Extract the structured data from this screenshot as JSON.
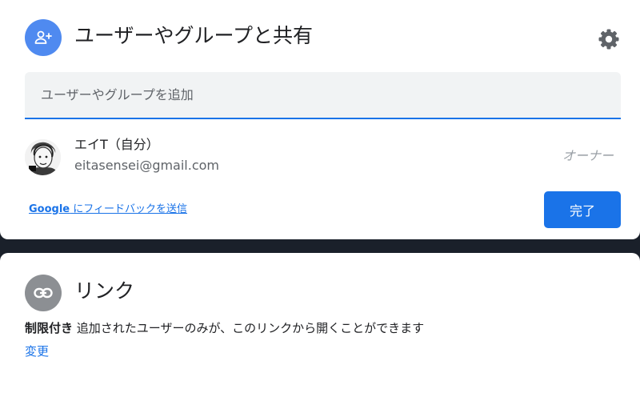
{
  "share_dialog": {
    "title": "ユーザーやグループと共有",
    "add_people_icon": "person-add-icon",
    "settings_icon": "gear-icon",
    "input": {
      "placeholder": "ユーザーやグループを追加",
      "value": ""
    },
    "people": [
      {
        "name": "エイT（自分）",
        "email": "eitasensei@gmail.com",
        "role": "オーナー"
      }
    ],
    "feedback": {
      "brand": "Google",
      "text": " にフィードバックを送信"
    },
    "done_label": "完了"
  },
  "link_section": {
    "title": "リンク",
    "icon": "link-icon",
    "restricted_label": "制限付き",
    "description": " 追加されたユーザーのみが、このリンクから開くことができます",
    "change_label": "変更"
  },
  "colors": {
    "primary": "#1a73e8",
    "header_icon_bg": "#4f8af0",
    "link_icon_bg": "#8c8f93",
    "backdrop": "#1a202a"
  }
}
